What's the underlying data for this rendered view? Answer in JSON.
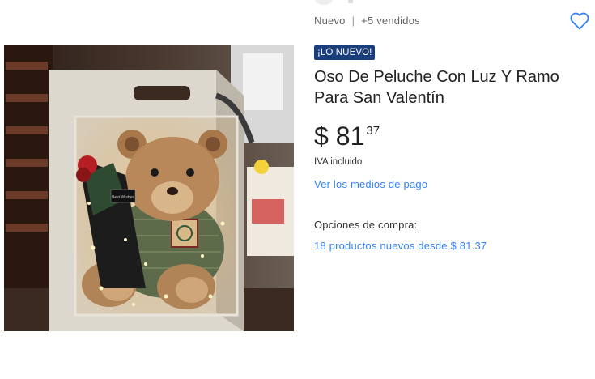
{
  "product": {
    "condition": "Nuevo",
    "separator": "|",
    "sold": "+5 vendidos",
    "badge": "¡LO NUEVO!",
    "title": "Oso De Peluche Con Luz Y Ramo Para San Valentín",
    "price": {
      "symbol": "$",
      "integer": "81",
      "cents": "37"
    },
    "tax_note": "IVA incluido",
    "payment_link": "Ver los medios de pago",
    "purchase_options_label": "Opciones de compra:",
    "purchase_options_link": "18 productos nuevos desde $ 81.37",
    "image_alt": "Oso de peluche en bolsa de regalo con ramo de rosa y luces",
    "bouquet_card": "Best Wishes"
  },
  "icons": {
    "favorite": "heart-outline-icon"
  },
  "colors": {
    "accent_blue": "#3483fa",
    "badge_bg": "#1a3d7c"
  }
}
